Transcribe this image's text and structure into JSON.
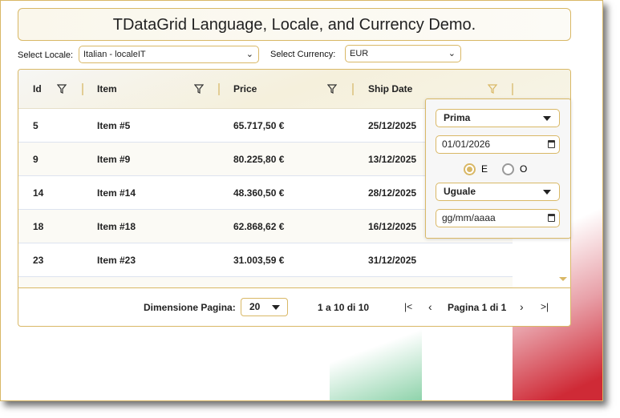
{
  "title": "TDataGrid Language, Locale, and Currency Demo.",
  "locale": {
    "label": "Select Locale:",
    "value": "Italian - localeIT"
  },
  "currency": {
    "label": "Select Currency:",
    "value": "EUR"
  },
  "columns": [
    "Id",
    "Item",
    "Price",
    "Ship Date"
  ],
  "rows": [
    {
      "id": "5",
      "item": "Item #5",
      "price": "65.717,50 €",
      "date": "25/12/2025"
    },
    {
      "id": "9",
      "item": "Item #9",
      "price": "80.225,80 €",
      "date": "13/12/2025"
    },
    {
      "id": "14",
      "item": "Item #14",
      "price": "48.360,50 €",
      "date": "28/12/2025"
    },
    {
      "id": "18",
      "item": "Item #18",
      "price": "62.868,62 €",
      "date": "16/12/2025"
    },
    {
      "id": "23",
      "item": "Item #23",
      "price": "31.003,59 €",
      "date": "31/12/2025"
    }
  ],
  "footer": {
    "page_size_label": "Dimensione Pagina:",
    "page_size": "20",
    "range": "1 a 10 di 10",
    "page": "Pagina 1 di 1"
  },
  "filter": {
    "op1": "Prima",
    "date1": "01/01/2026",
    "and": "E",
    "or": "O",
    "op2": "Uguale",
    "date2": "gg/mm/aaaa"
  },
  "colors": {
    "accent": "#d9b866",
    "red": "#cf2a36",
    "green": "#8fd3ab"
  }
}
